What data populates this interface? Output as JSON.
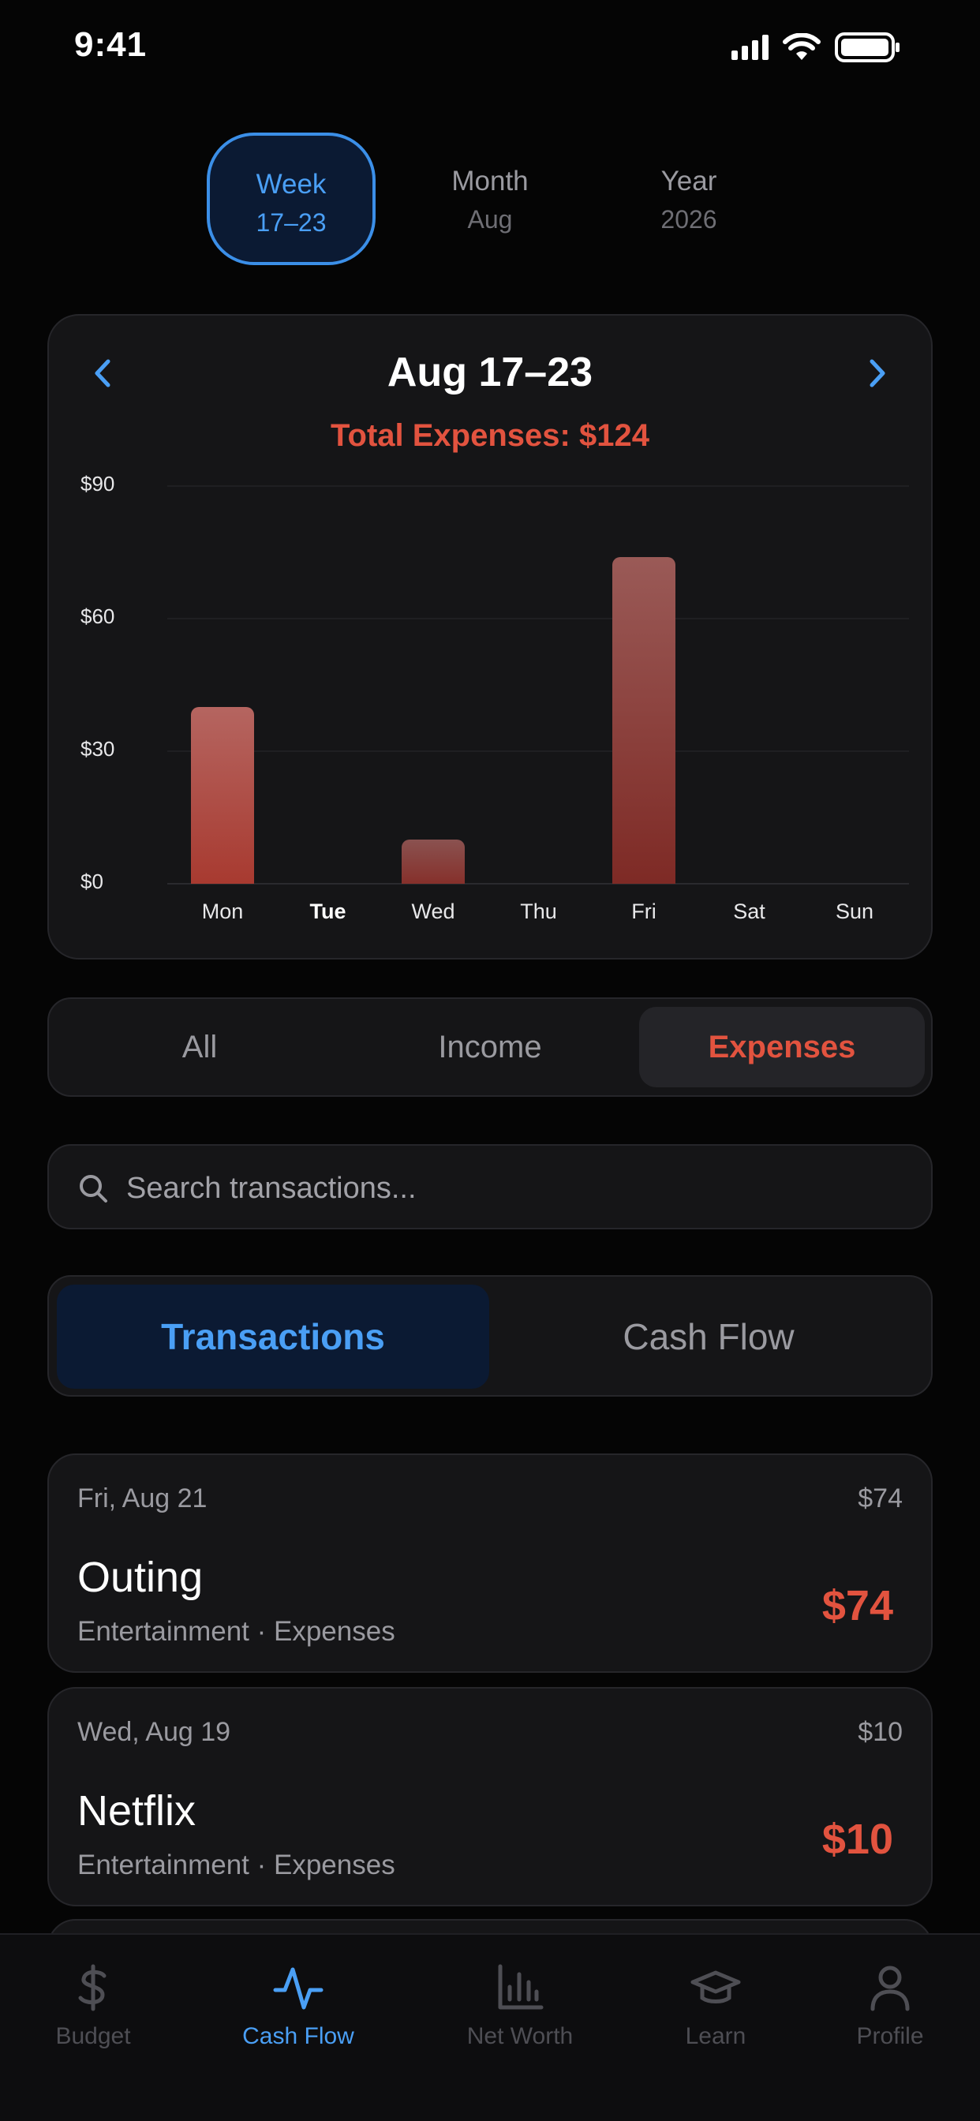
{
  "status_bar": {
    "time": "9:41",
    "icons": [
      "signal-icon",
      "wifi-icon",
      "battery-icon"
    ]
  },
  "period_tabs": [
    {
      "label": "Week",
      "sub": "17–23",
      "active": true
    },
    {
      "label": "Month",
      "sub": "Aug",
      "active": false
    },
    {
      "label": "Year",
      "sub": "2026",
      "active": false
    }
  ],
  "chart": {
    "title": "Aug 17–23",
    "total": "Total Expenses: $124",
    "prev_icon": "chevron-left-icon",
    "next_icon": "chevron-right-icon"
  },
  "chart_data": {
    "type": "bar",
    "categories": [
      "Mon",
      "Tue",
      "Wed",
      "Thu",
      "Fri",
      "Sat",
      "Sun"
    ],
    "values": [
      40,
      0,
      10,
      0,
      74,
      0,
      0
    ],
    "ylim": [
      0,
      90
    ],
    "yticks": [
      "$0",
      "$30",
      "$60",
      "$90"
    ],
    "ytick_values": [
      0,
      30,
      60,
      90
    ],
    "highlighted_category": "Tue",
    "grid": true,
    "bar_color": "#b04a40"
  },
  "filter": {
    "options": [
      "All",
      "Income",
      "Expenses"
    ],
    "selected": "Expenses"
  },
  "search": {
    "placeholder": "Search transactions..."
  },
  "view_tabs": {
    "options": [
      "Transactions",
      "Cash Flow"
    ],
    "selected": "Transactions"
  },
  "transactions": [
    {
      "date": "Fri, Aug 21",
      "day_total": "$74",
      "name": "Outing",
      "category": "Entertainment · Expenses",
      "amount": "$74"
    },
    {
      "date": "Wed, Aug 19",
      "day_total": "$10",
      "name": "Netflix",
      "category": "Entertainment · Expenses",
      "amount": "$10"
    }
  ],
  "bottom_nav": [
    {
      "label": "Budget",
      "icon": "dollar-icon",
      "active": false
    },
    {
      "label": "Cash Flow",
      "icon": "pulse-icon",
      "active": true
    },
    {
      "label": "Net Worth",
      "icon": "bar-chart-icon",
      "active": false
    },
    {
      "label": "Learn",
      "icon": "graduation-cap-icon",
      "active": false
    },
    {
      "label": "Profile",
      "icon": "person-icon",
      "active": false
    }
  ],
  "colors": {
    "accent": "#4a9ff5",
    "expense": "#e2533f",
    "background": "#050505",
    "card": "#151517"
  }
}
